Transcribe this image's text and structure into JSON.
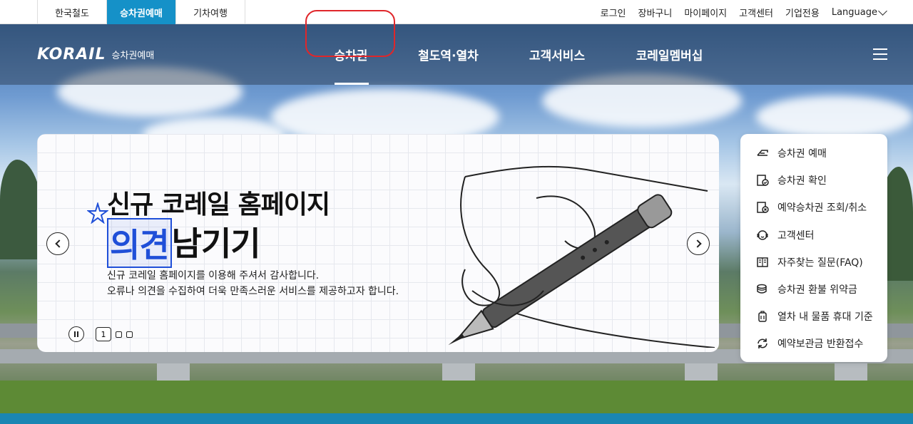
{
  "site_tabs": [
    "한국철도",
    "승차권예매",
    "기차여행"
  ],
  "util_links": [
    "로그인",
    "장바구니",
    "마이페이지",
    "고객센터",
    "기업전용",
    "Language"
  ],
  "logo": {
    "main": "KORAIL",
    "sub": "승차권예매"
  },
  "nav": [
    "승차권",
    "철도역·열차",
    "고객서비스",
    "코레일멤버십"
  ],
  "banner": {
    "title_line1": "신규 코레일 홈페이지",
    "title_em": "의견",
    "title_rest": "남기기",
    "desc_line1": "신규 코레일 홈페이지를 이용해 주셔서 감사합니다.",
    "desc_line2": "오류나 의견을 수집하여 더욱 만족스러운 서비스를 제공하고자 합니다.",
    "page_number": "1"
  },
  "quick_menu": [
    {
      "label": "승차권 예매",
      "icon": "ticket-icon"
    },
    {
      "label": "승차권 확인",
      "icon": "ticket-check-icon"
    },
    {
      "label": "예약승차권 조회/취소",
      "icon": "ticket-cancel-icon"
    },
    {
      "label": "고객센터",
      "icon": "headset-icon"
    },
    {
      "label": "자주찾는 질문(FAQ)",
      "icon": "book-icon"
    },
    {
      "label": "승차권 환불 위약금",
      "icon": "coins-icon"
    },
    {
      "label": "열차 내 물품 휴대 기준",
      "icon": "luggage-icon"
    },
    {
      "label": "예약보관금 반환접수",
      "icon": "refresh-icon"
    }
  ],
  "colors": {
    "accent": "#1591c8",
    "highlight": "#e0262a",
    "title_em": "#1f4fd8"
  }
}
